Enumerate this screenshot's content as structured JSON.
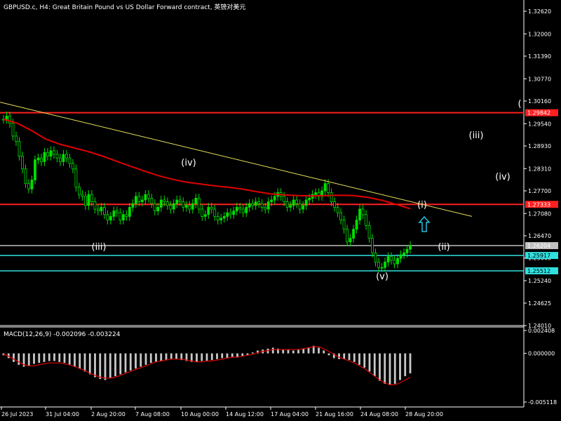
{
  "header": {
    "symbol_title": "GBPUSD.c, H4:  Great Britain Pound vs US Dollar Forward contract, 英镑对美元"
  },
  "colors": {
    "background": "#000000",
    "grid": "#ffffff",
    "bull_candle": "#00e000",
    "bear_candle": "#00e000",
    "moving_average": "#e00000",
    "trendline": "#e8e05a",
    "red_level": "#ff2020",
    "cyan_level": "#30e0e0",
    "gray_level": "#c0c0c0",
    "macd_histogram": "#c8c8c8",
    "macd_signal": "#e00000",
    "arrow": "#20c0e0",
    "axis_text": "#ffffff"
  },
  "chart_data": [
    {
      "type": "line",
      "name": "price_panel",
      "y_ticks": [
        "1.32620",
        "1.32000",
        "1.31390",
        "1.30770",
        "1.30160",
        "1.29540",
        "1.28930",
        "1.28310",
        "1.27700",
        "1.27080",
        "1.26470",
        "1.25860",
        "1.25240",
        "1.24625",
        "1.24010"
      ],
      "ylim": [
        1.2401,
        1.3262
      ],
      "x_ticks": [
        "26 Jul 2023",
        "31 Jul 04:00",
        "2 Aug 20:00",
        "7 Aug 08:00",
        "10 Aug 00:00",
        "14 Aug 12:00",
        "17 Aug 04:00",
        "21 Aug 16:00",
        "24 Aug 08:00",
        "28 Aug 20:00"
      ],
      "candle_closes": [
        1.2966,
        1.2975,
        1.2955,
        1.292,
        1.2905,
        1.2865,
        1.283,
        1.279,
        1.2775,
        1.28,
        1.2855,
        1.286,
        1.285,
        1.2875,
        1.2865,
        1.288,
        1.287,
        1.286,
        1.285,
        1.287,
        1.286,
        1.2845,
        1.283,
        1.278,
        1.276,
        1.2755,
        1.273,
        1.276,
        1.274,
        1.272,
        1.2715,
        1.2725,
        1.2705,
        1.269,
        1.27,
        1.2715,
        1.271,
        1.269,
        1.2705,
        1.27,
        1.2725,
        1.2735,
        1.2755,
        1.274,
        1.2745,
        1.276,
        1.275,
        1.2735,
        1.2715,
        1.2725,
        1.2745,
        1.274,
        1.273,
        1.272,
        1.2735,
        1.2745,
        1.274,
        1.2725,
        1.273,
        1.272,
        1.2735,
        1.275,
        1.272,
        1.27,
        1.2705,
        1.2725,
        1.272,
        1.27,
        1.269,
        1.2695,
        1.27,
        1.271,
        1.2705,
        1.2715,
        1.2725,
        1.272,
        1.271,
        1.2725,
        1.2735,
        1.273,
        1.274,
        1.2735,
        1.2725,
        1.272,
        1.274,
        1.2745,
        1.2755,
        1.2765,
        1.2755,
        1.274,
        1.2725,
        1.273,
        1.2745,
        1.2735,
        1.272,
        1.273,
        1.2745,
        1.275,
        1.276,
        1.2765,
        1.2755,
        1.277,
        1.279,
        1.2765,
        1.274,
        1.2725,
        1.271,
        1.269,
        1.2665,
        1.263,
        1.264,
        1.2665,
        1.269,
        1.272,
        1.2705,
        1.2675,
        1.264,
        1.26,
        1.2575,
        1.256,
        1.256,
        1.2575,
        1.259,
        1.258,
        1.257,
        1.2585,
        1.2595,
        1.26,
        1.261,
        1.262
      ],
      "series": [
        {
          "name": "moving_average",
          "values": [
            1.2966,
            1.2955,
            1.2935,
            1.2912,
            1.2898,
            1.2888,
            1.2878,
            1.2866,
            1.2852,
            1.2838,
            1.2825,
            1.2812,
            1.2802,
            1.2794,
            1.2789,
            1.2784,
            1.278,
            1.2775,
            1.2768,
            1.2762,
            1.2759,
            1.2757,
            1.2756,
            1.2757,
            1.2758,
            1.2757,
            1.2752,
            1.2744,
            1.2733,
            1.2721
          ]
        },
        {
          "name": "trendline",
          "values": [
            1.3013,
            1.27
          ]
        }
      ],
      "horizontal_levels": [
        {
          "name": "red_upper",
          "value": 1.2984,
          "label": "1.29842"
        },
        {
          "name": "red_lower",
          "value": 1.2733,
          "label": "1.27333"
        },
        {
          "name": "gray",
          "value": 1.262,
          "label": "1.26204"
        },
        {
          "name": "cyan_upper",
          "value": 1.2593,
          "label": "1.25917"
        },
        {
          "name": "cyan_lower",
          "value": 1.2551,
          "label": "1.25512"
        }
      ],
      "wave_labels": [
        "(iii)",
        "(iv)",
        "(v)",
        "(i)",
        "(ii)",
        "(iii)",
        "(iv)",
        "("
      ]
    },
    {
      "type": "bar",
      "name": "macd_panel",
      "title": "MACD(12,26,9) -0.002096 -0.003224",
      "y_ticks": [
        "0.002408",
        "0.000000",
        "-0.005118"
      ],
      "ylim": [
        -0.005118,
        0.002408
      ],
      "histogram": [
        -0.0002,
        -0.0005,
        -0.0009,
        -0.0012,
        -0.0014,
        -0.0013,
        -0.0011,
        -0.001,
        -0.0009,
        -0.0008,
        -0.0008,
        -0.0009,
        -0.001,
        -0.0012,
        -0.0014,
        -0.0016,
        -0.0019,
        -0.0022,
        -0.0025,
        -0.0027,
        -0.0028,
        -0.0026,
        -0.0024,
        -0.0022,
        -0.002,
        -0.0018,
        -0.0016,
        -0.0014,
        -0.0012,
        -0.001,
        -0.0009,
        -0.0008,
        -0.0007,
        -0.0006,
        -0.0006,
        -0.0007,
        -0.0008,
        -0.0009,
        -0.0009,
        -0.0008,
        -0.0008,
        -0.0007,
        -0.0006,
        -0.0005,
        -0.0005,
        -0.0004,
        -0.0004,
        -0.0003,
        -0.0002,
        0.0001,
        0.0003,
        0.0004,
        0.0005,
        0.0006,
        0.0005,
        0.0004,
        0.0004,
        0.0003,
        0.0004,
        0.0005,
        0.0006,
        0.0008,
        0.0006,
        0.0003,
        -0.0002,
        -0.0005,
        -0.0006,
        -0.0006,
        -0.0007,
        -0.0009,
        -0.0012,
        -0.0015,
        -0.0019,
        -0.0024,
        -0.0029,
        -0.0032,
        -0.0033,
        -0.0032,
        -0.0028,
        -0.0024,
        -0.0021
      ],
      "signal": [
        -0.0001,
        -0.0003,
        -0.0006,
        -0.0009,
        -0.0012,
        -0.0013,
        -0.0013,
        -0.0012,
        -0.0011,
        -0.001,
        -0.001,
        -0.001,
        -0.0011,
        -0.0012,
        -0.0014,
        -0.0016,
        -0.0018,
        -0.0021,
        -0.0023,
        -0.0025,
        -0.0026,
        -0.0026,
        -0.0025,
        -0.0023,
        -0.0021,
        -0.0019,
        -0.0017,
        -0.0015,
        -0.0013,
        -0.0011,
        -0.0009,
        -0.0008,
        -0.0007,
        -0.0006,
        -0.0006,
        -0.0006,
        -0.0007,
        -0.0008,
        -0.0009,
        -0.0009,
        -0.0008,
        -0.0008,
        -0.0007,
        -0.0006,
        -0.0005,
        -0.0004,
        -0.0004,
        -0.0003,
        -0.0002,
        -0.0001,
        0.0001,
        0.0002,
        0.0003,
        0.0004,
        0.0004,
        0.0004,
        0.0004,
        0.0004,
        0.0004,
        0.0005,
        0.0006,
        0.0007,
        0.0007,
        0.0005,
        0.0002,
        -0.0001,
        -0.0004,
        -0.0006,
        -0.0008,
        -0.001,
        -0.0013,
        -0.0016,
        -0.002,
        -0.0024,
        -0.0028,
        -0.0031,
        -0.0033,
        -0.0033,
        -0.0031,
        -0.0028,
        -0.0025
      ]
    }
  ]
}
